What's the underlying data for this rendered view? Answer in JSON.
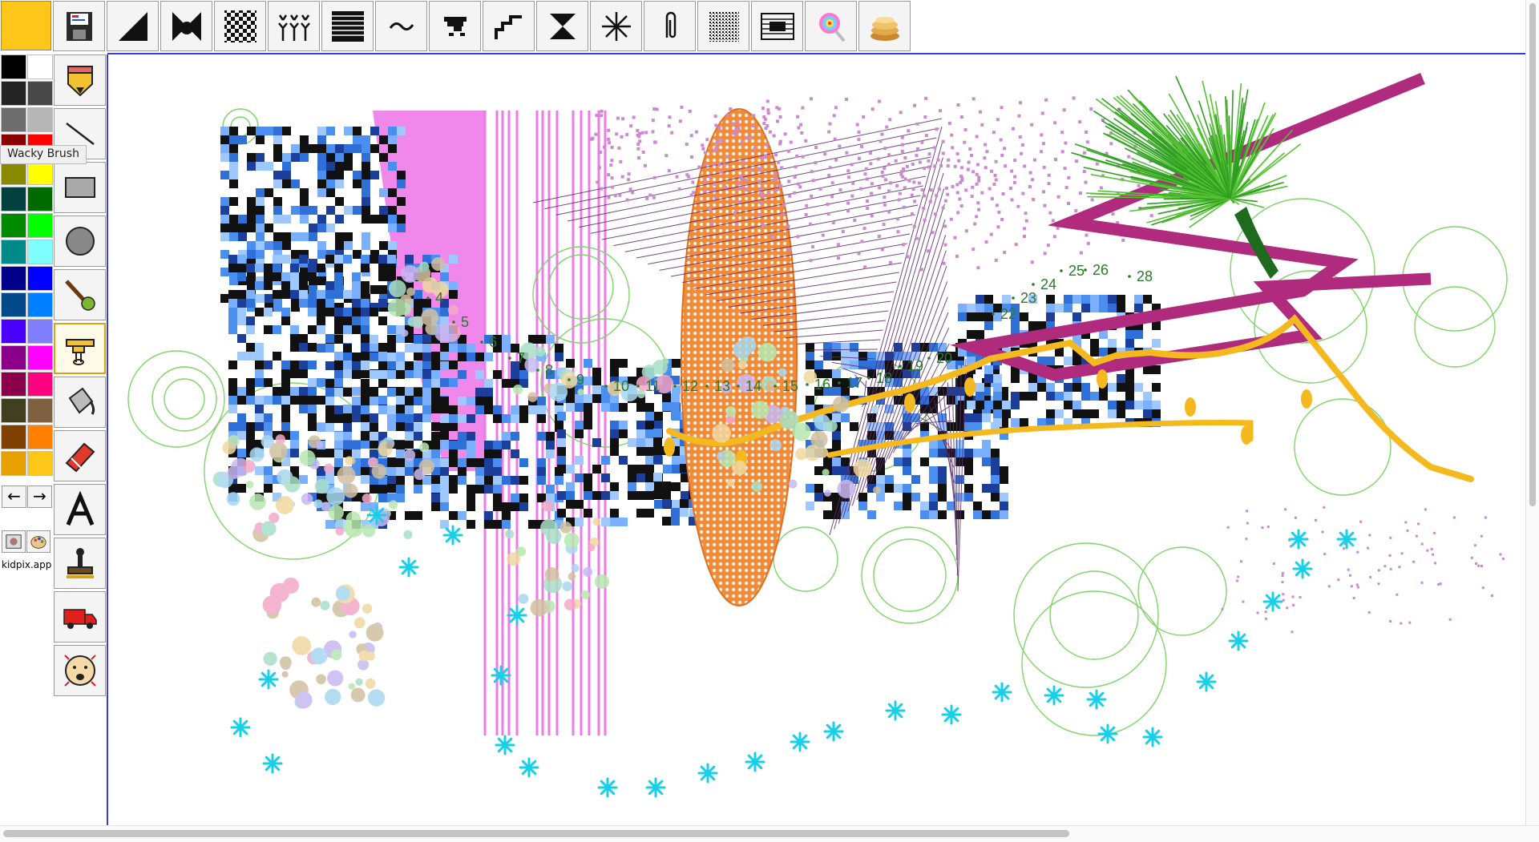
{
  "app": {
    "name": "kidpix.app",
    "selected_color": "#ffc61a"
  },
  "tooltip": {
    "text": "Wacky Brush"
  },
  "top_toolbar": {
    "items": [
      {
        "icon": "save-icon"
      },
      {
        "icon": "diagonal-fill-icon"
      },
      {
        "icon": "bowtie-icon"
      },
      {
        "icon": "checkerboard-icon"
      },
      {
        "icon": "leaf-pattern-icon"
      },
      {
        "icon": "stripes-icon"
      },
      {
        "icon": "squiggle-icon"
      },
      {
        "icon": "pixel-cloud-icon"
      },
      {
        "icon": "steps-icon"
      },
      {
        "icon": "hourglass-icon"
      },
      {
        "icon": "starburst-icon"
      },
      {
        "icon": "paperclip-icon"
      },
      {
        "icon": "noise-icon"
      },
      {
        "icon": "film-strip-icon"
      },
      {
        "icon": "lollipop-icon"
      },
      {
        "icon": "pancakes-icon"
      }
    ]
  },
  "palette": {
    "colors": [
      "#000000",
      "#ffffff",
      "#242424",
      "#484848",
      "#6d6d6d",
      "#b6b6b6",
      "#8a0000",
      "#ff0000",
      "#8a8a00",
      "#ffff00",
      "#00403f",
      "#006b00",
      "#008a00",
      "#00ff00",
      "#008a8a",
      "#80ffff",
      "#00008a",
      "#0000ff",
      "#004a8a",
      "#0080ff",
      "#4a00ff",
      "#8080ff",
      "#8a008a",
      "#ff00ff",
      "#8a004a",
      "#ff0080",
      "#403f1f",
      "#806040",
      "#804000",
      "#ff8000",
      "#e6a000",
      "#ffc61a"
    ],
    "prev_arrow": "←",
    "next_arrow": "→"
  },
  "tools": [
    {
      "name": "tool-pencil",
      "icon": "pencil-icon"
    },
    {
      "name": "tool-line",
      "icon": "line-icon"
    },
    {
      "name": "tool-rectangle",
      "icon": "rectangle-icon"
    },
    {
      "name": "tool-circle",
      "icon": "circle-icon"
    },
    {
      "name": "tool-wacky-brush",
      "icon": "paintbrush-icon"
    },
    {
      "name": "tool-mixer",
      "icon": "electric-mixer-icon"
    },
    {
      "name": "tool-paint-bucket",
      "icon": "paint-bucket-icon"
    },
    {
      "name": "tool-eraser",
      "icon": "eraser-icon"
    },
    {
      "name": "tool-text",
      "icon": "text-a-icon",
      "label": "A"
    },
    {
      "name": "tool-stamp",
      "icon": "rubber-stamp-icon"
    },
    {
      "name": "tool-truck",
      "icon": "moving-truck-icon"
    },
    {
      "name": "tool-undo-face",
      "icon": "face-icon"
    }
  ],
  "canvas": {
    "number_labels": [
      "4",
      "5",
      "6",
      "7",
      "8",
      "9",
      "10",
      "11",
      "12",
      "13",
      "14",
      "15",
      "16",
      "17",
      "18",
      "19",
      "20",
      "22",
      "23",
      "24",
      "25",
      "26",
      "28"
    ]
  }
}
